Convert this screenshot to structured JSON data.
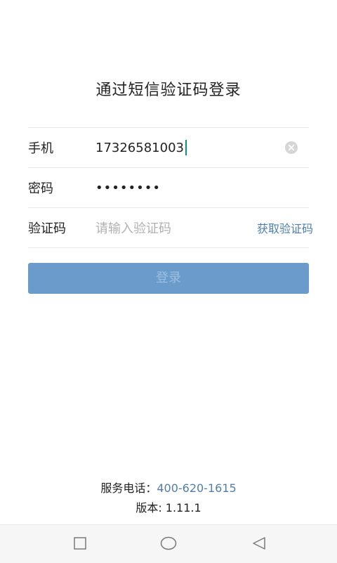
{
  "title": "通过短信验证码登录",
  "form": {
    "phone_label": "手机",
    "phone_value": "17326581003",
    "password_label": "密码",
    "password_value": "••••••••",
    "code_label": "验证码",
    "code_placeholder": "请输入验证码",
    "get_code_label": "获取验证码"
  },
  "login_button": "登录",
  "footer": {
    "service_label": "服务电话：",
    "service_phone": "400-620-1615",
    "version_text": "版本: 1.11.1"
  },
  "icons": {
    "clear": "clear-icon",
    "nav_recent": "square-icon",
    "nav_home": "circle-icon",
    "nav_back": "triangle-back-icon"
  },
  "colors": {
    "accent_button": "#6b9bca",
    "link": "#4f7ead",
    "caret": "#0f8f7f"
  }
}
